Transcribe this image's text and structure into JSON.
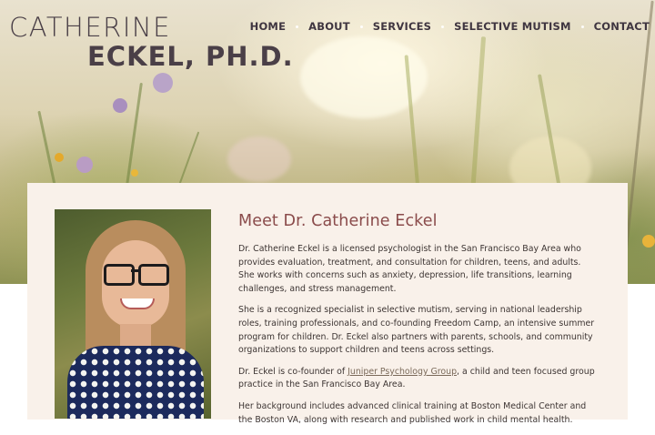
{
  "site": {
    "logo_line1": "CATHERINE",
    "logo_line2": "ECKEL, PH.D."
  },
  "nav": {
    "items": [
      "HOME",
      "ABOUT",
      "SERVICES",
      "SELECTIVE MUTISM",
      "CONTACT"
    ]
  },
  "about": {
    "heading": "Meet Dr. Catherine Eckel",
    "p1": "Dr. Catherine Eckel is a licensed psychologist in the San Francisco Bay Area who provides evaluation, treatment, and consultation for children, teens, and adults. She works with concerns such as anxiety, depression, life transitions, learning challenges, and stress management.",
    "p2": "She is a recognized specialist in selective mutism, serving in national leadership roles, training professionals, and co-founding Freedom Camp, an intensive summer program for children. Dr. Eckel also partners with parents, schools, and community organizations to support children and teens across settings.",
    "p3_before": "Dr. Eckel is co-founder of ",
    "p3_link": "Juniper Psychology Group",
    "p3_after": ", a child and teen focused group practice in the San Francisco Bay Area.",
    "p4": "Her background includes advanced clinical training at Boston Medical Center and the Boston VA, along with research and published work in child mental health."
  },
  "colors": {
    "logo_text": "#4a3f47",
    "heading_accent": "#8a4b4b",
    "card_background": "#f9f1ea"
  },
  "icons": {
    "photo": "portrait-photo",
    "hero": "meadow-background-image"
  }
}
